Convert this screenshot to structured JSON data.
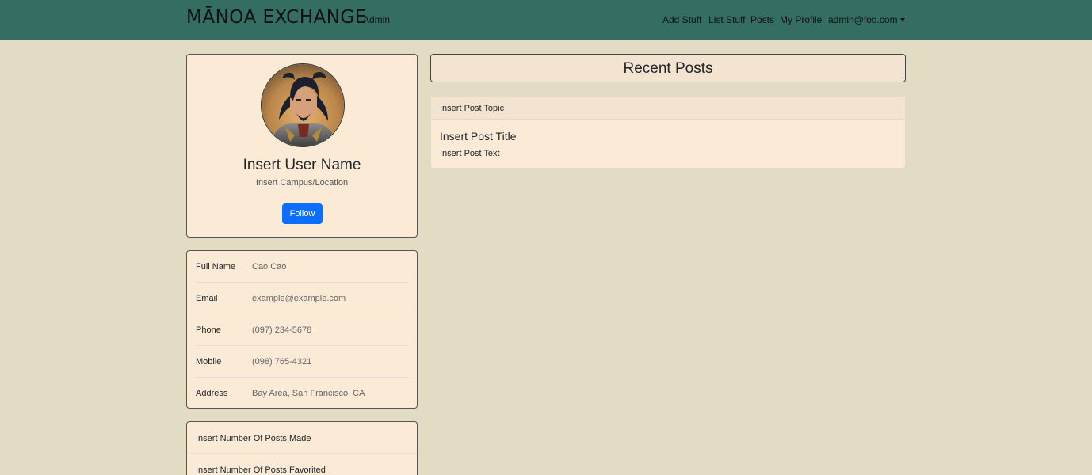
{
  "navbar": {
    "brand": "MĀNOA EXCHANGE",
    "admin_link": "Admin",
    "links": [
      "Add Stuff",
      "List Stuff",
      "Posts",
      "My Profile"
    ],
    "user_menu": "admin@foo.com",
    "bg_color": "#346e63"
  },
  "profile": {
    "name": "Insert User Name",
    "campus": "Insert Campus/Location",
    "follow_label": "Follow"
  },
  "info": {
    "rows": [
      {
        "label": "Full Name",
        "value": "Cao Cao"
      },
      {
        "label": "Email",
        "value": "example@example.com"
      },
      {
        "label": "Phone",
        "value": "(097) 234-5678"
      },
      {
        "label": "Mobile",
        "value": "(098) 765-4321"
      },
      {
        "label": "Address",
        "value": "Bay Area, San Francisco, CA"
      }
    ]
  },
  "stats": {
    "posts_made": "Insert Number Of Posts Made",
    "posts_favorited": "Insert Number Of Posts Favorited"
  },
  "recent": {
    "heading": "Recent Posts",
    "post": {
      "topic": "Insert Post Topic",
      "title": "Insert Post Title",
      "text": "Insert Post Text"
    }
  },
  "colors": {
    "page_bg": "#e3dcc4",
    "card_bg": "#fbebd6",
    "accent_button": "#0d6efd"
  }
}
